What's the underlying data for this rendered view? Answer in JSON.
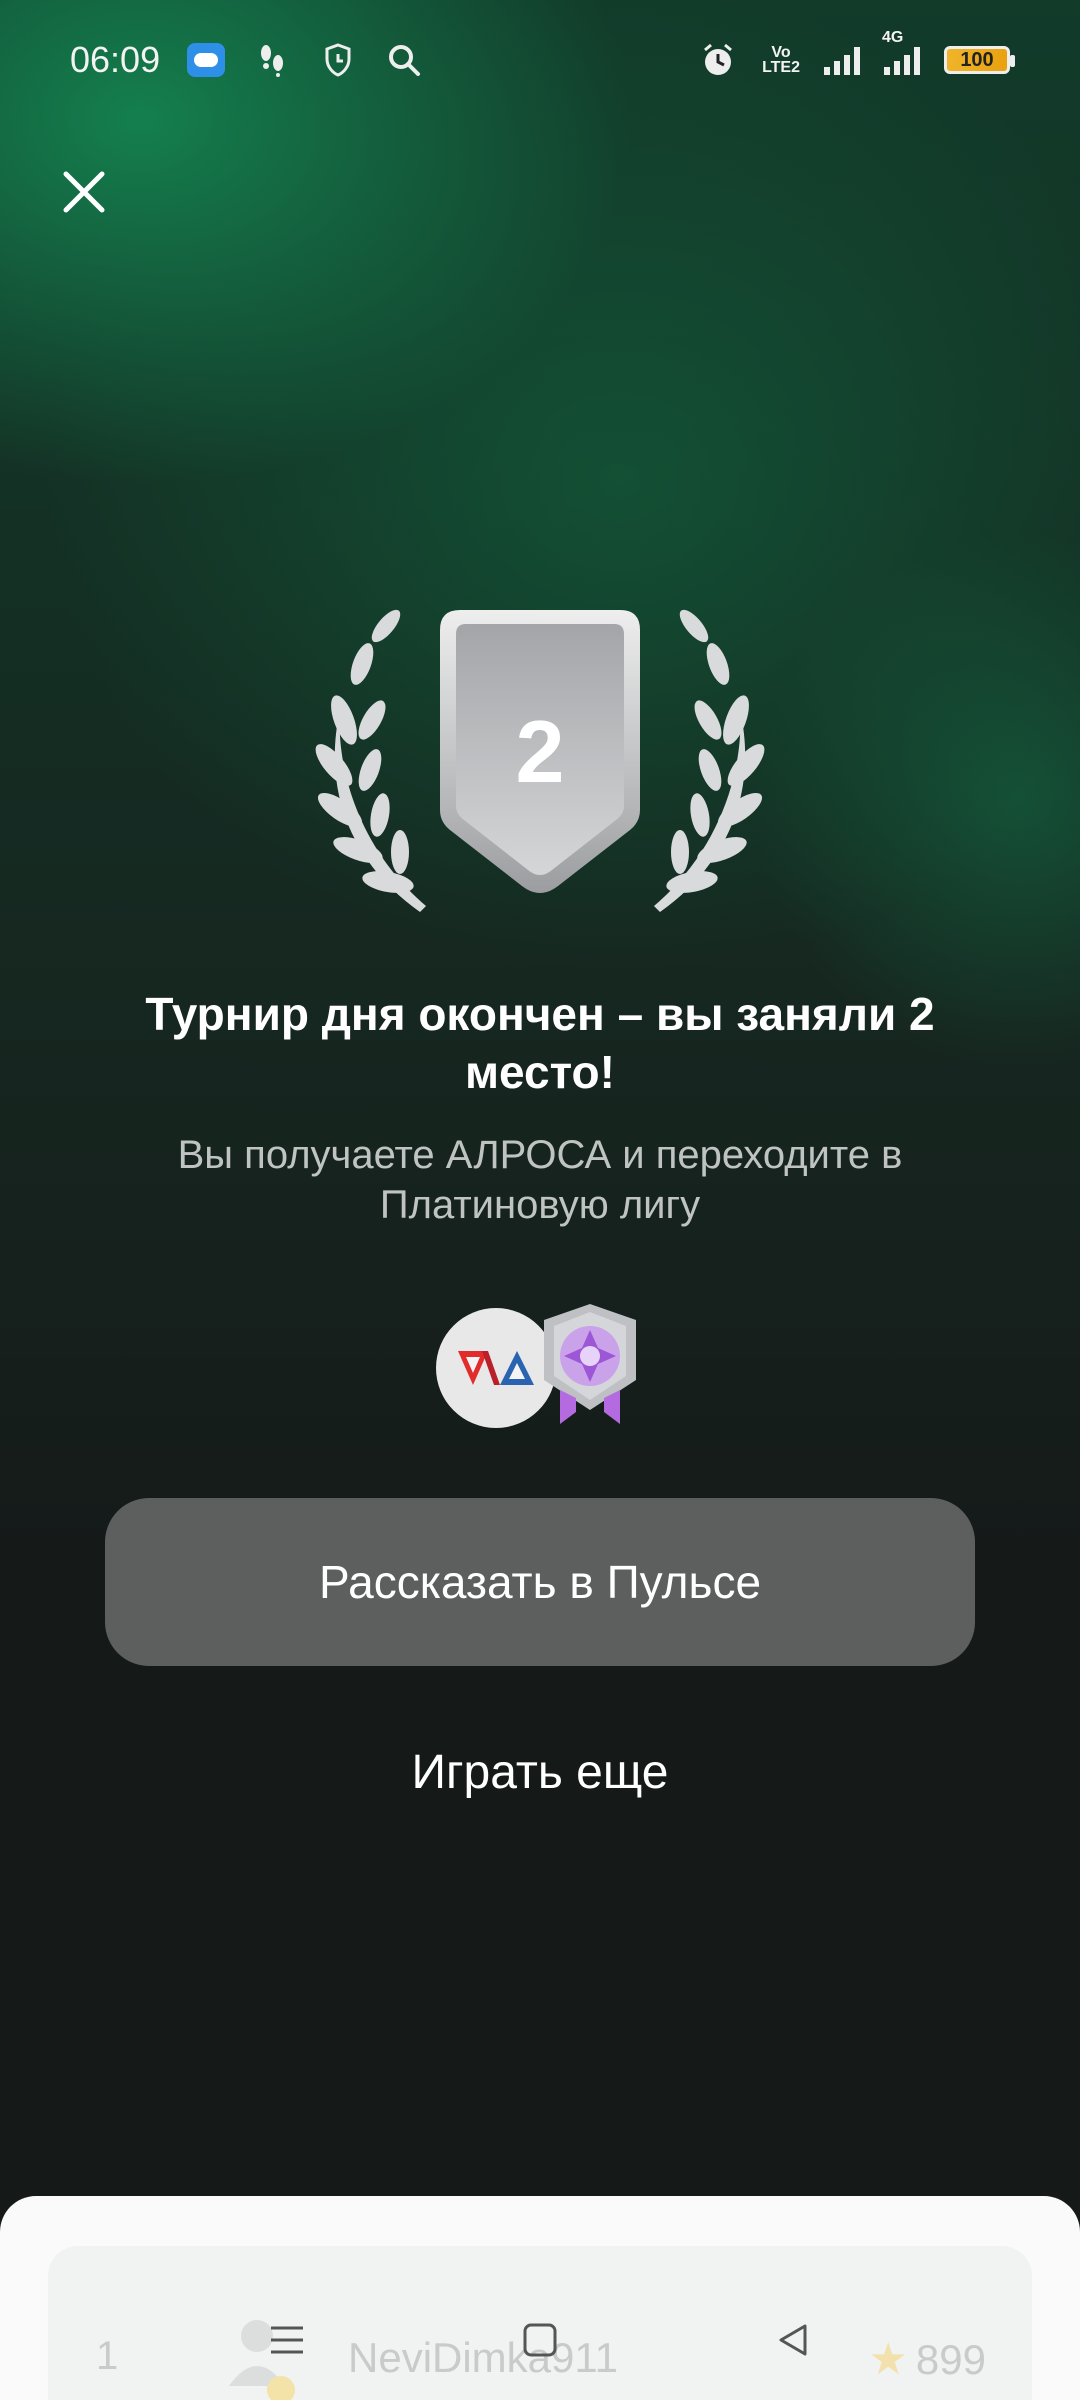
{
  "status_bar": {
    "time": "06:09",
    "volte": [
      "Vo",
      "LTE2"
    ],
    "network": "4G",
    "battery": "100"
  },
  "result": {
    "place": "2",
    "title": "Турнир дня окончен – вы заняли 2 место!",
    "subtitle": "Вы получаете АЛРОСА и переходите в Платиновую лигу"
  },
  "buttons": {
    "share_label": "Рассказать в Пульсе",
    "play_label": "Играть еще"
  },
  "leaderboard": {
    "row": {
      "rank": "1",
      "name": "NeviDimka911",
      "score": "899"
    }
  },
  "colors": {
    "accent_green": "#138a55",
    "button_gray": "#5c5f5e",
    "league_purple": "#b46be0",
    "alrosa_red": "#e22b2b",
    "alrosa_blue": "#2a63b0"
  },
  "icons": {
    "close": "close-icon",
    "alarm": "alarm-icon",
    "search": "search-icon",
    "trophy": "silver-shield-laurel-icon",
    "league": "platinum-league-badge-icon",
    "alrosa": "alrosa-logo-icon"
  }
}
